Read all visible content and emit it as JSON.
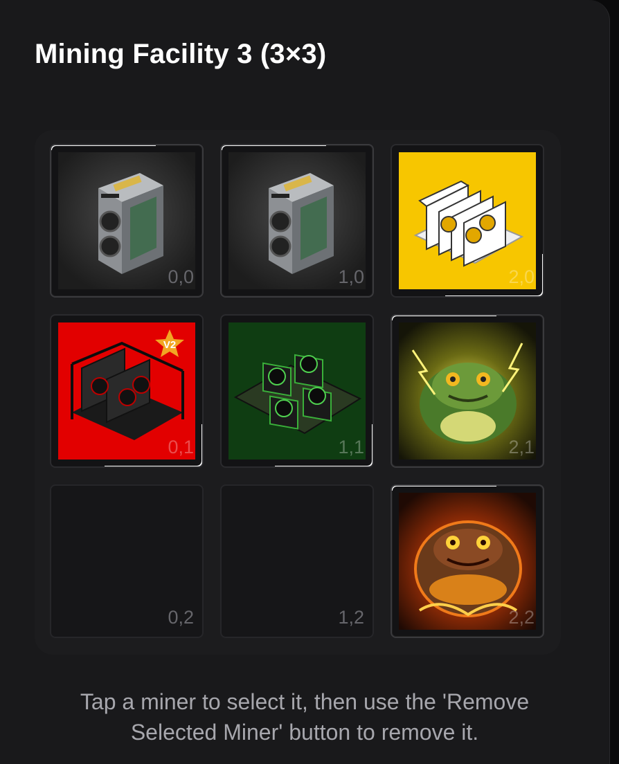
{
  "facility": {
    "title": "Mining Facility 3 (3×3)"
  },
  "grid": {
    "cells": [
      {
        "coord": "0,0",
        "miner": "asic-miner",
        "bg": "#2b2b2b"
      },
      {
        "coord": "1,0",
        "miner": "asic-miner",
        "bg": "#2b2b2b"
      },
      {
        "coord": "2,0",
        "miner": "gpu-rig-white",
        "bg": "#f5c400"
      },
      {
        "coord": "0,1",
        "miner": "gpu-rig-red",
        "bg": "#e00000",
        "badge": "V2"
      },
      {
        "coord": "1,1",
        "miner": "fpga-board-green",
        "bg": "#0f3d12"
      },
      {
        "coord": "2,1",
        "miner": "toad-electric",
        "bg": "#3a3a10"
      },
      {
        "coord": "0,2",
        "miner": "",
        "bg": ""
      },
      {
        "coord": "1,2",
        "miner": "",
        "bg": ""
      },
      {
        "coord": "2,2",
        "miner": "toad-fire",
        "bg": "#4a1a06"
      }
    ]
  },
  "hint": {
    "line1": "Tap a miner to select it, then use the 'Remove",
    "line2": "Selected Miner' button to remove it."
  },
  "colors": {
    "panel": "#19191b",
    "text": "#ffffff",
    "hint": "#a7a7ad"
  }
}
